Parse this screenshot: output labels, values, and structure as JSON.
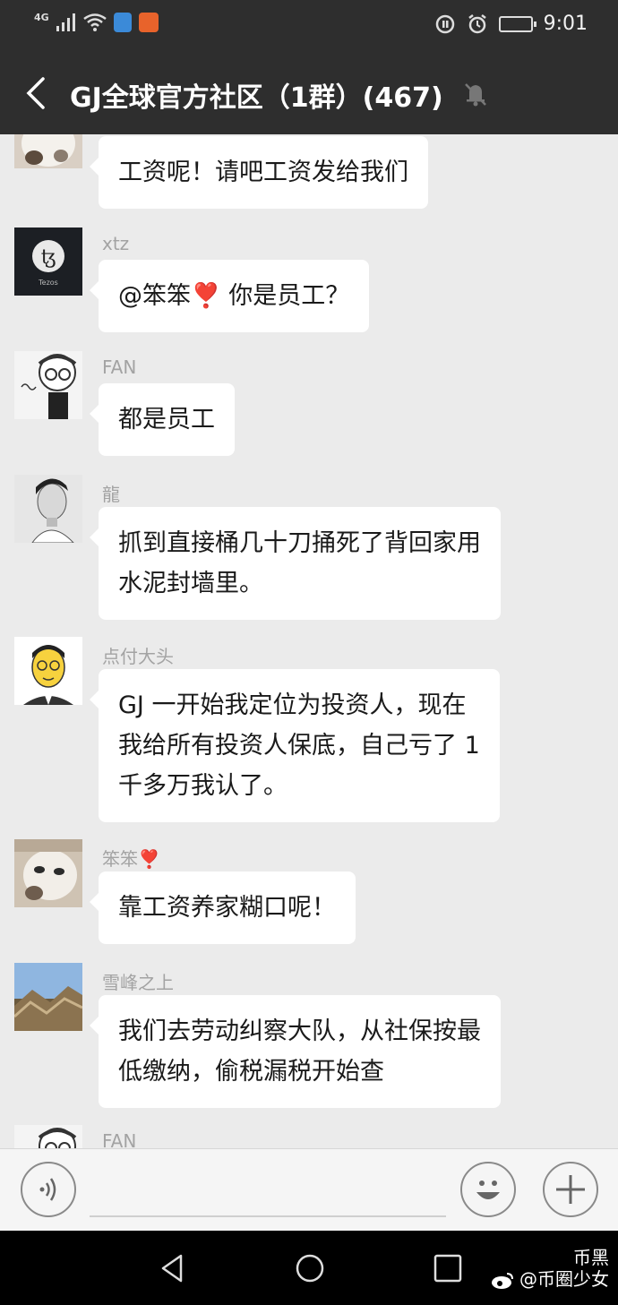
{
  "status_bar": {
    "network": "4G",
    "time": "9:01"
  },
  "header": {
    "title": "GJ全球官方社区（1群）(467)"
  },
  "messages": [
    {
      "sender": "",
      "text": "工资呢！请吧工资发给我们",
      "avatar": "cat-avatar"
    },
    {
      "sender": "xtz",
      "text": "@笨笨❣️ 你是员工？",
      "avatar": "tezos-avatar",
      "avatar_label": "Tezos"
    },
    {
      "sender": "FAN",
      "text": "都是员工",
      "avatar": "cartoon-boy-avatar"
    },
    {
      "sender": "龍",
      "text": "抓到直接桶几十刀捅死了背回家用\n水泥封墙里。",
      "avatar": "man-portrait-avatar"
    },
    {
      "sender": "点付大头",
      "text": "GJ 一开始我定位为投资人，现在\n我给所有投资人保底，自己亏了 1\n千多万我认了。",
      "avatar": "cartoon-man-avatar"
    },
    {
      "sender": "笨笨❣️",
      "text": "靠工资养家糊口呢！",
      "avatar": "cat-avatar"
    },
    {
      "sender": "雪峰之上",
      "text": "我们去劳动纠察大队，从社保按最\n低缴纳，偷税漏税开始查",
      "avatar": "great-wall-avatar"
    },
    {
      "sender": "FAN",
      "text": "",
      "avatar": "cartoon-boy-avatar"
    }
  ],
  "input": {
    "placeholder": ""
  },
  "watermark": {
    "line1": "币黑",
    "line2": "@币圈少女"
  },
  "colors": {
    "header_bg": "#2e2e2e",
    "chat_bg": "#ebebeb",
    "bubble_bg": "#ffffff",
    "sender_color": "#a3a3a3"
  }
}
